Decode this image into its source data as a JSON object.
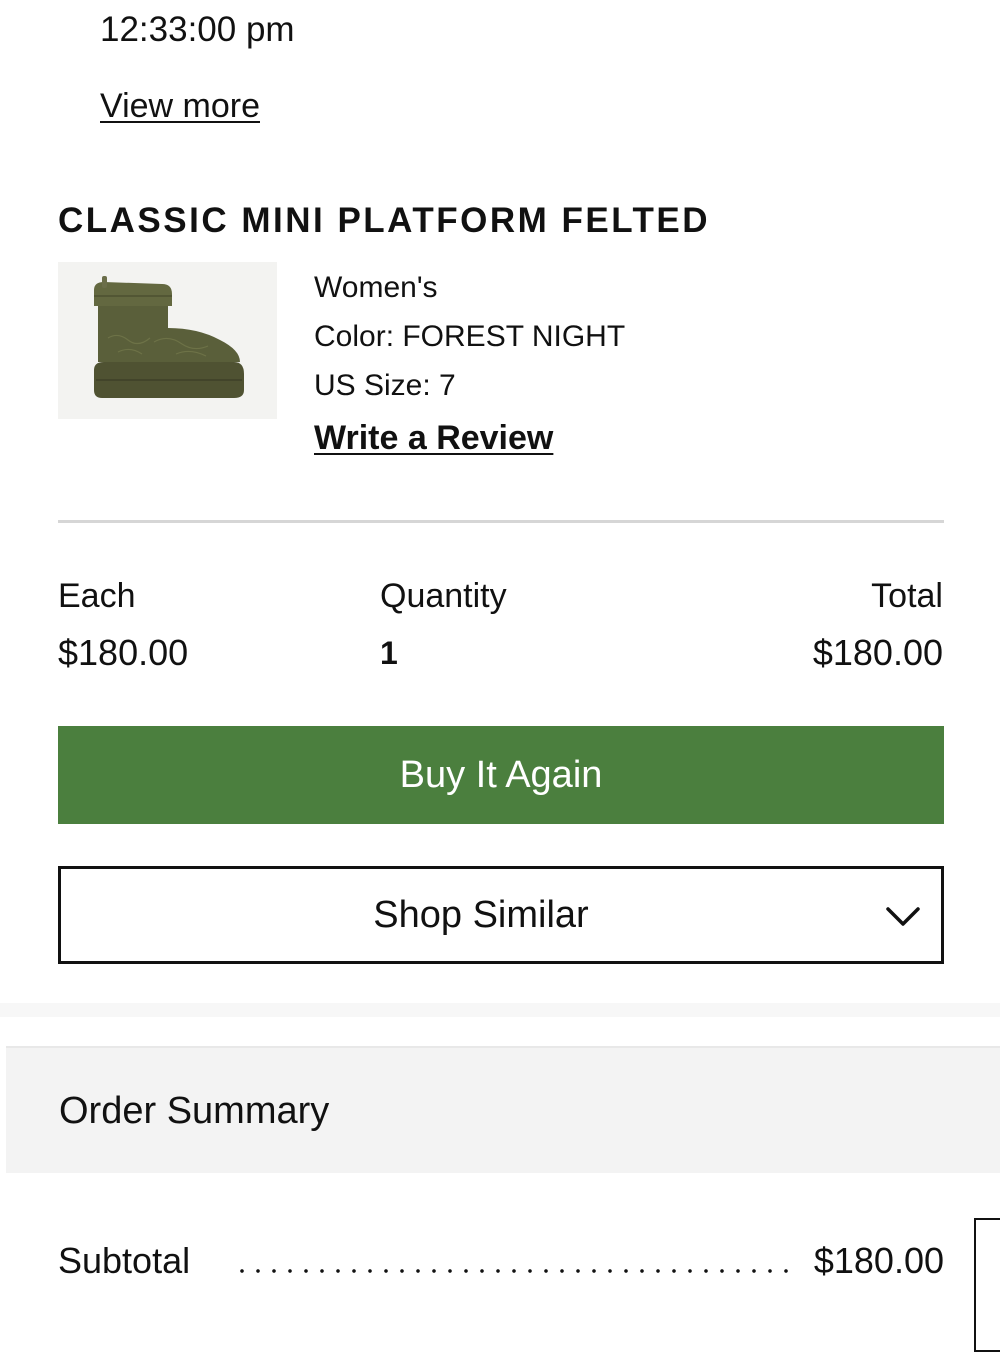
{
  "order": {
    "time": "12:33:00 pm",
    "view_more": "View more"
  },
  "product": {
    "title": "CLASSIC MINI PLATFORM FELTED",
    "image_icon": "boot-product-image",
    "gender": "Women's",
    "color": "Color: FOREST NIGHT",
    "size": "US Size: 7",
    "write_review": "Write a Review"
  },
  "pricing": {
    "each_label": "Each",
    "each_value": "$180.00",
    "quantity_label": "Quantity",
    "quantity_value": "1",
    "total_label": "Total",
    "total_value": "$180.00"
  },
  "actions": {
    "buy_again": "Buy It Again",
    "shop_similar": "Shop Similar",
    "shop_similar_icon": "chevron-down-icon"
  },
  "summary": {
    "title": "Order Summary",
    "subtotal_label": "Subtotal",
    "subtotal_value": "$180.00"
  },
  "colors": {
    "accent_green": "#4b7f3e",
    "boot_olive": "#5a5f3a"
  }
}
